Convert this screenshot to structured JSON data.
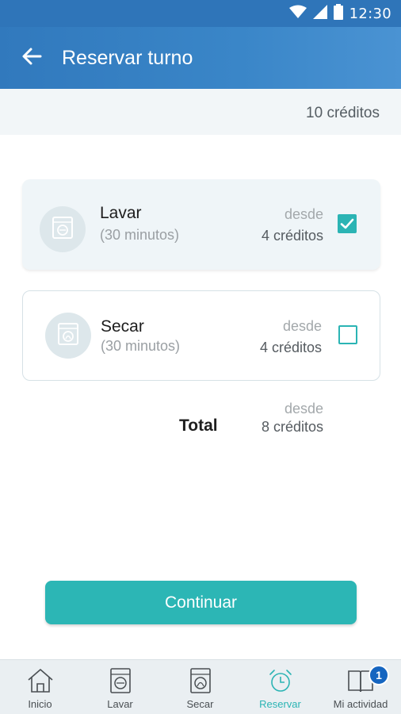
{
  "status_bar": {
    "time": "12:30"
  },
  "app_bar": {
    "title": "Reservar turno"
  },
  "credits": {
    "text": "10 créditos"
  },
  "services": [
    {
      "name": "Lavar",
      "duration": "(30 minutos)",
      "price_prefix": "desde",
      "price": "4 créditos",
      "checked": true,
      "icon": "washer-icon"
    },
    {
      "name": "Secar",
      "duration": "(30 minutos)",
      "price_prefix": "desde",
      "price": "4 créditos",
      "checked": false,
      "icon": "dryer-icon"
    }
  ],
  "total": {
    "label": "Total",
    "prefix": "desde",
    "value": "8 créditos"
  },
  "continue_button": {
    "label": "Continuar"
  },
  "bottom_nav": {
    "items": [
      {
        "label": "Inicio",
        "icon": "home-icon",
        "active": false
      },
      {
        "label": "Lavar",
        "icon": "washer-icon",
        "active": false
      },
      {
        "label": "Secar",
        "icon": "dryer-icon",
        "active": false
      },
      {
        "label": "Reservar",
        "icon": "alarm-clock-icon",
        "active": true
      },
      {
        "label": "Mi actividad",
        "icon": "book-icon",
        "active": false,
        "badge": "1"
      }
    ]
  },
  "colors": {
    "primary": "#2f75b9",
    "accent": "#2cb6b5",
    "badge": "#1565c0"
  }
}
